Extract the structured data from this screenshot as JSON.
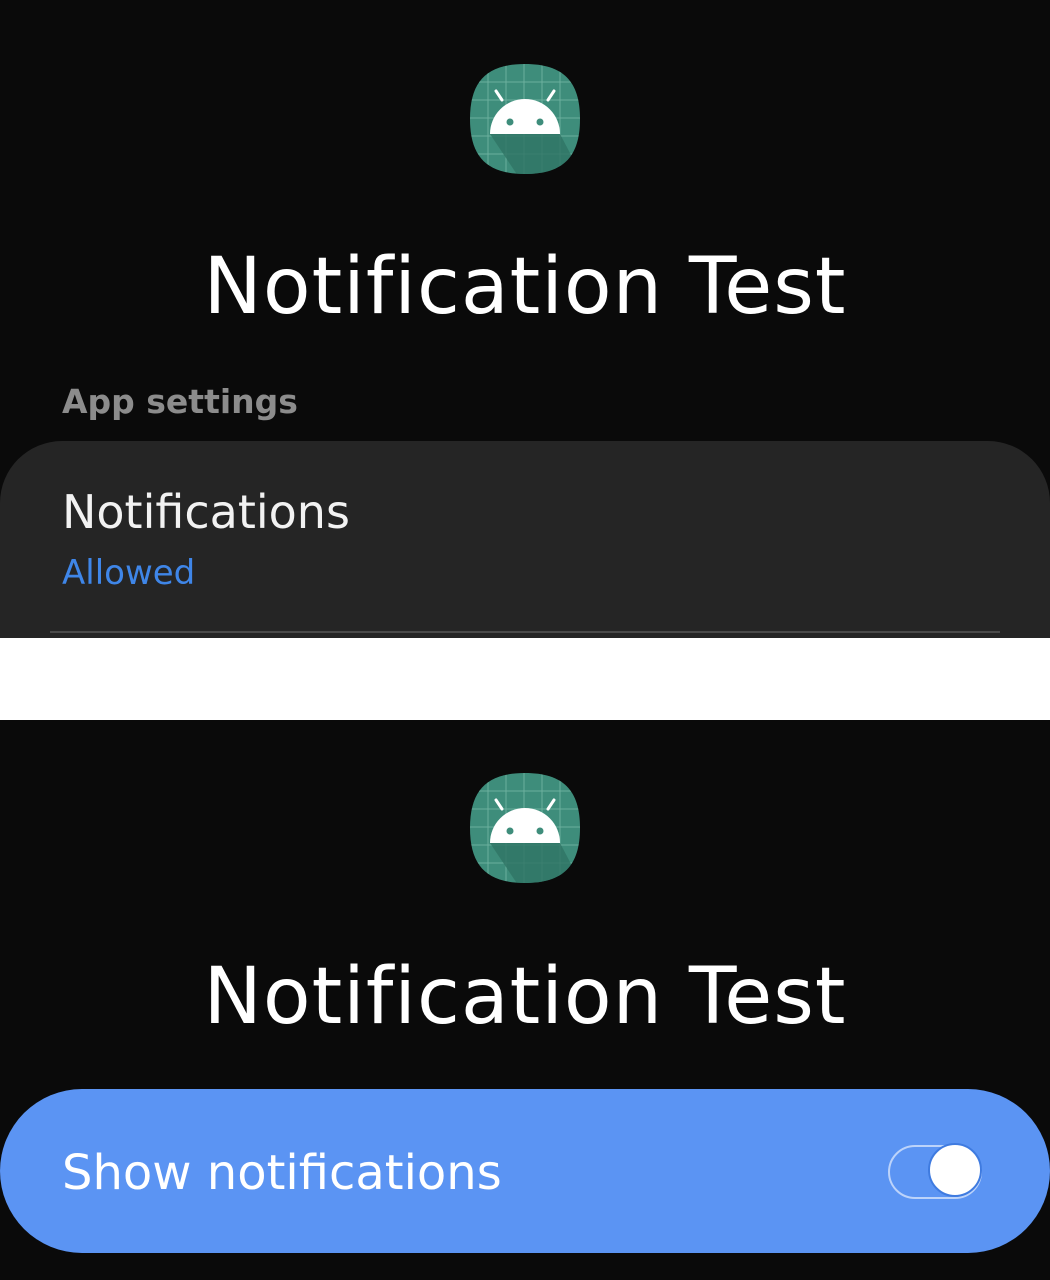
{
  "screens": [
    {
      "app_name": "Notification Test",
      "icon": "android-robot-icon",
      "section_header": "App settings",
      "notifications_item": {
        "title": "Notifications",
        "status": "Allowed"
      }
    },
    {
      "app_name": "Notification Test",
      "icon": "android-robot-icon",
      "toggle": {
        "label": "Show notifications",
        "state": "on"
      }
    }
  ],
  "colors": {
    "background": "#0a0a0a",
    "card": "#252525",
    "accent_blue": "#3f86e8",
    "toggle_row": "#5b94f3",
    "icon_teal": "#3e8d7b"
  }
}
